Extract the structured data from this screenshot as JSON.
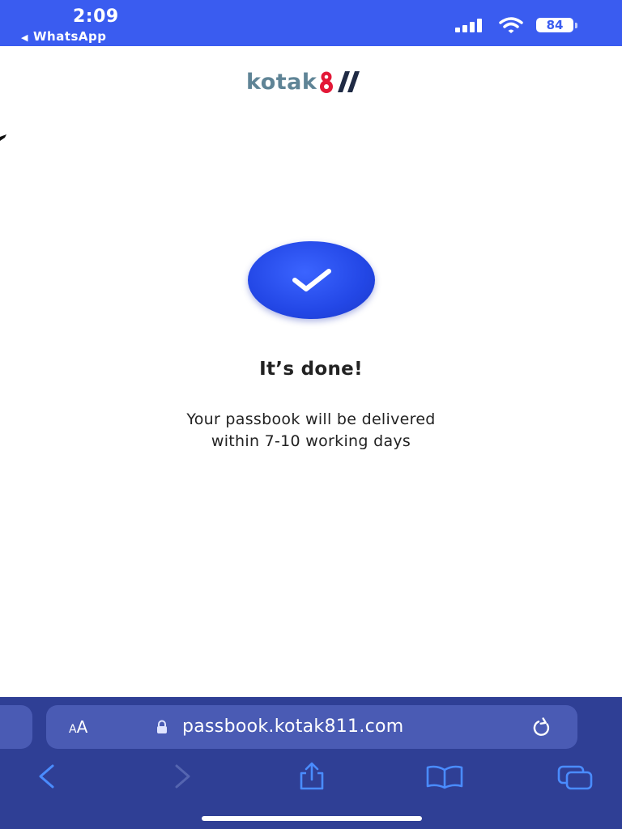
{
  "status_bar": {
    "time": "2:09",
    "back_app": "WhatsApp",
    "battery_level": "84"
  },
  "brand": {
    "logo_text": "kotak",
    "logo_color": "#5f8496",
    "accent_color": "#e31837"
  },
  "confirmation": {
    "title": "It’s done!",
    "message_line1": "Your passbook will be delivered",
    "message_line2": "within 7-10 working days"
  },
  "browser": {
    "text_size_small": "A",
    "text_size_large": "A",
    "url": "passbook.kotak811.com"
  },
  "icons": {
    "status": [
      "cellular-signal-icon",
      "wifi-icon",
      "battery-icon"
    ],
    "content": [
      "checkmark-icon"
    ],
    "toolbar": [
      "back-icon",
      "forward-icon",
      "share-icon",
      "bookmarks-icon",
      "tabs-icon"
    ],
    "address": [
      "lock-icon",
      "reload-icon"
    ]
  },
  "colors": {
    "status_bar_bg": "#3a5cf0",
    "check_badge": "#2347e6",
    "browser_bar_bg": "#2f3f95",
    "address_bar_bg": "#4a5bb4",
    "toolbar_icon": "#4a8cff"
  }
}
